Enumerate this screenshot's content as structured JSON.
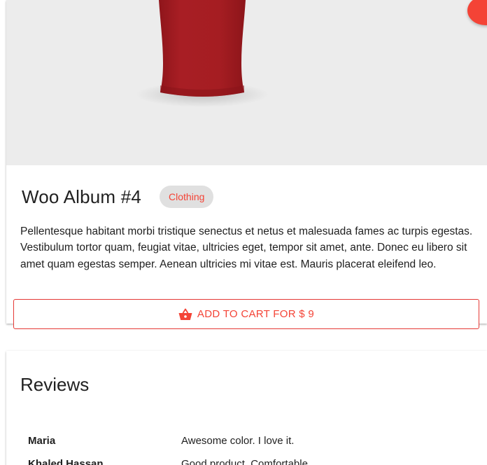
{
  "product": {
    "title": "Woo Album #4",
    "category": "Clothing",
    "description": "Pellentesque habitant morbi tristique senectus et netus et malesuada fames ac turpis egestas. Vestibulum tortor quam, feugiat vitae, ultricies eget, tempor sit amet, ante. Donec eu libero sit amet quam egestas semper. Aenean ultricies mi vitae est. Mauris placerat eleifend leo.",
    "add_to_cart_label": "ADD TO CART FOR $ 9",
    "cart_icon": "shopping-basket-icon",
    "image_subject": "red-t-shirt"
  },
  "reviews": {
    "title": "Reviews",
    "items": [
      {
        "name": "Maria",
        "comment": "Awesome color. I love it."
      },
      {
        "name": "Khaled Hassan",
        "comment": "Good product. Comfortable."
      }
    ]
  },
  "colors": {
    "accent": "#f44336",
    "image_background": "#ececec",
    "shirt": "#a51d22",
    "chip_background": "#e0e0e0"
  }
}
